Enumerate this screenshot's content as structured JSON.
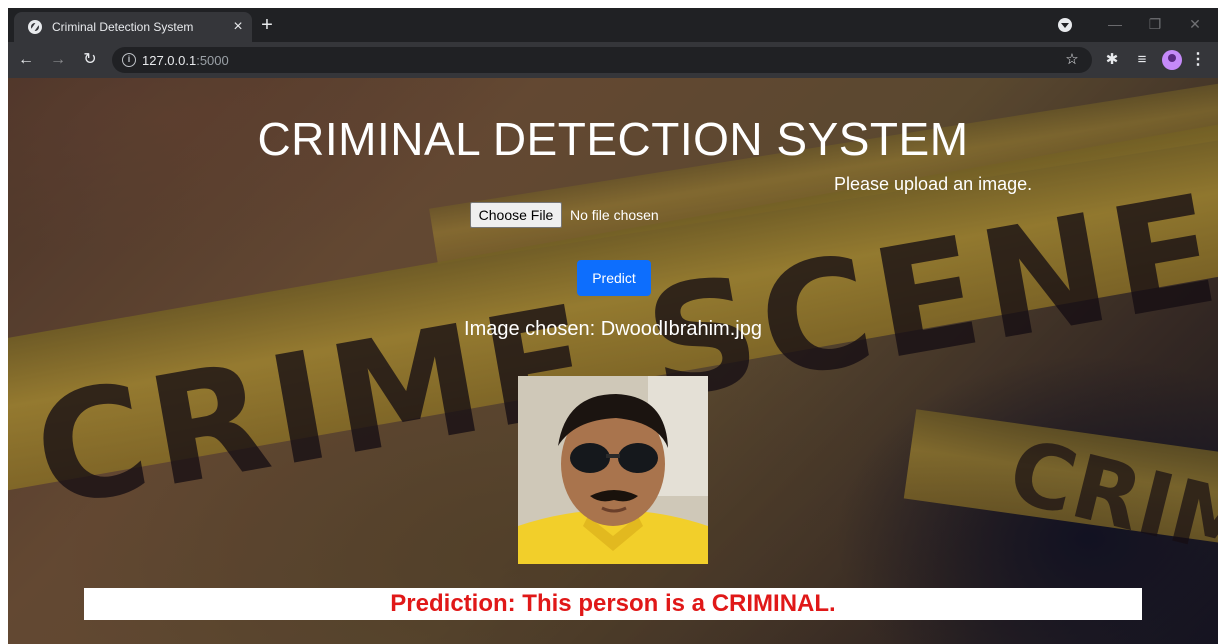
{
  "browser": {
    "tab_title": "Criminal Detection System",
    "tab_close_glyph": "×",
    "new_tab_glyph": "+",
    "url_host": "127.0.0.1",
    "url_port": ":5000",
    "icons": [
      "globe-icon",
      "close-icon",
      "plus-icon",
      "back-icon",
      "forward-icon",
      "reload-icon",
      "info-icon",
      "star-icon",
      "extensions-icon",
      "reading-list-icon",
      "avatar",
      "menu-icon"
    ]
  },
  "page": {
    "title": "CRIMINAL DETECTION SYSTEM",
    "upload_hint": "Please upload an image.",
    "choose_file_label": "Choose File",
    "no_file_text": "No file chosen",
    "predict_label": "Predict",
    "chosen_text": "Image chosen: DwoodIbrahim.jpg",
    "prediction_text": "Prediction: This person is a CRIMINAL.",
    "background_tape_text": "CRIME SCENE DO NOT",
    "background_tape_text_2": "CRIM"
  },
  "colors": {
    "predict_button": "#0d6efd",
    "prediction_text": "#e01818"
  }
}
